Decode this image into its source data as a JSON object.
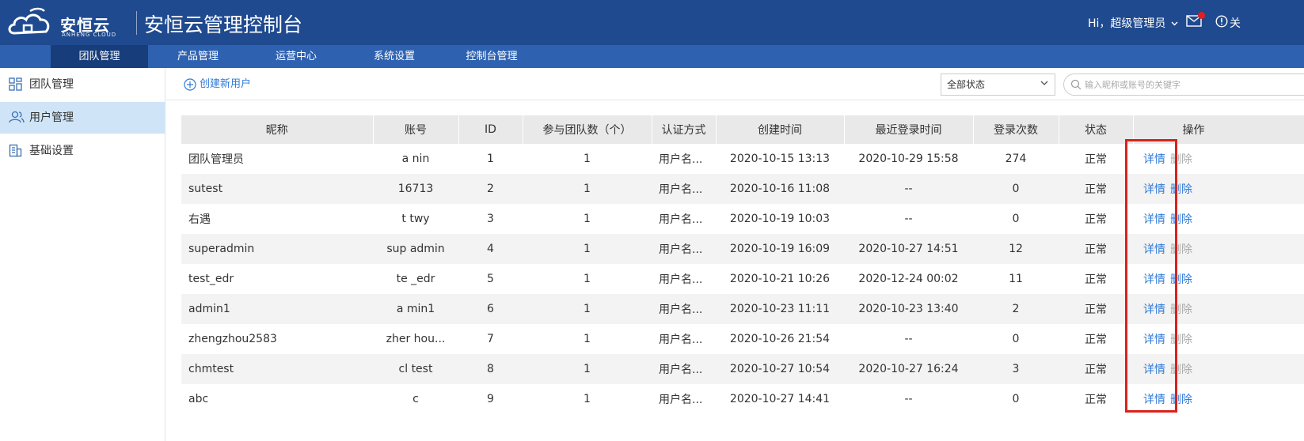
{
  "header": {
    "logo_text": "安恒云",
    "logo_sub": "ANHENG CLOUD",
    "app_title": "安恒云管理控制台",
    "greeting": "Hi，超级管理员",
    "info_label": "关"
  },
  "nav": {
    "tabs": [
      {
        "label": "团队管理",
        "active": true
      },
      {
        "label": "产品管理",
        "active": false
      },
      {
        "label": "运营中心",
        "active": false
      },
      {
        "label": "系统设置",
        "active": false
      },
      {
        "label": "控制台管理",
        "active": false
      }
    ]
  },
  "sidebar": {
    "items": [
      {
        "label": "团队管理",
        "icon": "grid-icon",
        "active": false
      },
      {
        "label": "用户管理",
        "icon": "users-icon",
        "active": true
      },
      {
        "label": "基础设置",
        "icon": "building-icon",
        "active": false
      }
    ]
  },
  "toolbar": {
    "create_label": "创建新用户",
    "status_value": "全部状态",
    "search_placeholder": "输入昵称或账号的关键字"
  },
  "table": {
    "columns": [
      "昵称",
      "账号",
      "ID",
      "参与团队数（个）",
      "认证方式",
      "创建时间",
      "最近登录时间",
      "登录次数",
      "状态",
      "操作"
    ],
    "detail_label": "详情",
    "delete_label": "删除",
    "rows": [
      {
        "nickname": "团队管理员",
        "account": "a   nin",
        "id": "1",
        "teams": "1",
        "auth": "用户名...",
        "created": "2020-10-15 13:13",
        "last_login": "2020-10-29 15:58",
        "logins": "274",
        "status": "正常",
        "delete_enabled": false
      },
      {
        "nickname": "sutest",
        "account": "16713",
        "id": "2",
        "teams": "1",
        "auth": "用户名...",
        "created": "2020-10-16 11:08",
        "last_login": "--",
        "logins": "0",
        "status": "正常",
        "delete_enabled": true
      },
      {
        "nickname": "右遇",
        "account": "t   twy",
        "id": "3",
        "teams": "1",
        "auth": "用户名...",
        "created": "2020-10-19 10:03",
        "last_login": "--",
        "logins": "0",
        "status": "正常",
        "delete_enabled": true
      },
      {
        "nickname": "superadmin",
        "account": "sup  admin",
        "id": "4",
        "teams": "1",
        "auth": "用户名...",
        "created": "2020-10-19 16:09",
        "last_login": "2020-10-27 14:51",
        "logins": "12",
        "status": "正常",
        "delete_enabled": false
      },
      {
        "nickname": "test_edr",
        "account": "te  _edr",
        "id": "5",
        "teams": "1",
        "auth": "用户名...",
        "created": "2020-10-21 10:26",
        "last_login": "2020-12-24 00:02",
        "logins": "11",
        "status": "正常",
        "delete_enabled": true
      },
      {
        "nickname": "admin1",
        "account": "a  min1",
        "id": "6",
        "teams": "1",
        "auth": "用户名...",
        "created": "2020-10-23 11:11",
        "last_login": "2020-10-23 13:40",
        "logins": "2",
        "status": "正常",
        "delete_enabled": false
      },
      {
        "nickname": "zhengzhou2583",
        "account": "zher  hou...",
        "id": "7",
        "teams": "1",
        "auth": "用户名...",
        "created": "2020-10-26 21:54",
        "last_login": "--",
        "logins": "0",
        "status": "正常",
        "delete_enabled": false
      },
      {
        "nickname": "chmtest",
        "account": "cl   test",
        "id": "8",
        "teams": "1",
        "auth": "用户名...",
        "created": "2020-10-27 10:54",
        "last_login": "2020-10-27 16:24",
        "logins": "3",
        "status": "正常",
        "delete_enabled": false
      },
      {
        "nickname": "abc",
        "account": "  c",
        "id": "9",
        "teams": "1",
        "auth": "用户名...",
        "created": "2020-10-27 14:41",
        "last_login": "--",
        "logins": "0",
        "status": "正常",
        "delete_enabled": true
      }
    ]
  },
  "colors": {
    "header_bg": "#1f4a8f",
    "nav_bg": "#2e62b1",
    "nav_active": "#173d7a",
    "link": "#2f7ad8",
    "highlight": "#d9221d"
  }
}
